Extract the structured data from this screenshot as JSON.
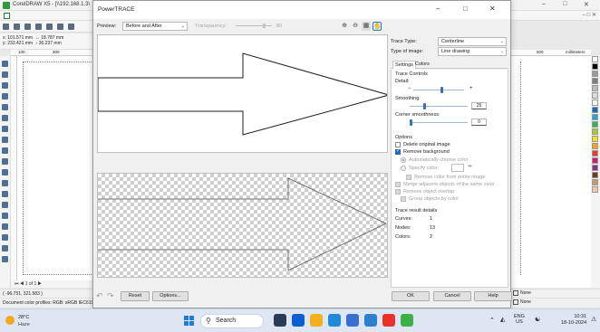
{
  "corel": {
    "title": "CorelDRAW X5 - [\\\\192.168.1.3\\",
    "window_controls": {
      "minimize": "–",
      "maximize": "□",
      "close": "✕"
    },
    "sub_window_controls": "– □ ✕",
    "propbar": {
      "x": "x: 101.571 mm",
      "y": "y: 233.421 mm",
      "w": "18.787 mm",
      "h": "36.237 mm"
    },
    "ruler_top": [
      "100",
      "300"
    ],
    "ruler_right": [
      "500",
      "millimeters"
    ],
    "page_nav": "1 of 1",
    "status_coords": "( -96.751, 321.583 )",
    "status_profile": "Document color profiles: RGB: sRGB IEC61966-2.1; CMYK: ISO Coated v2 (ECI); Grayscale: Dot Gain 15% ▶",
    "fill_status": "None",
    "outline_status": "None",
    "palette": [
      "#ffffff",
      "#000000",
      "#9a9a9a",
      "#7f7f7f",
      "#bcbcbc",
      "#dddddd",
      "#f4f4f4",
      "#1c66b2",
      "#2aa0d8",
      "#3bb34a",
      "#9acd3a",
      "#f2e21b",
      "#f7a21b",
      "#ee3a2a",
      "#d11f6a",
      "#8a2d8f",
      "#6a3d1e",
      "#c99a63",
      "#f4c8a4"
    ]
  },
  "powertrace": {
    "title": "PowerTRACE",
    "window_controls": {
      "minimize": "–",
      "maximize": "□",
      "close": "✕"
    },
    "preview_label": "Preview:",
    "preview_mode": "Before and After",
    "transparency_label": "Transparency:",
    "transparency_value": "80",
    "transparency_level": 0.8,
    "zoom_in_icon": "⊕",
    "zoom_out_icon": "⊖",
    "buttons": {
      "reset": "Reset",
      "options": "Options...",
      "ok": "OK",
      "cancel": "Cancel",
      "help": "Help"
    },
    "undo_icon": "↶",
    "redo_icon": "↷",
    "trace_type_label": "Trace Type:",
    "trace_type_value": "Centerline",
    "image_type_label": "Type of image:",
    "image_type_value": "Line drawing",
    "tabs": [
      "Settings",
      "Colors"
    ],
    "trace_controls_title": "Trace Controls",
    "detail_label": "Detail:",
    "detail_level": 0.55,
    "smoothing_label": "Smoothing:",
    "smoothing_value": "25",
    "smoothing_level": 0.25,
    "corner_label": "Corner smoothness:",
    "corner_value": "0",
    "corner_level": 0,
    "options_title": "Options",
    "delete_original": "Delete original image",
    "remove_background": "Remove background",
    "auto_color": "Automatically choose color",
    "specify_color": "Specify color:",
    "remove_color_entire": "Remove color from entire image",
    "merge_adjacent": "Merge adjacent objects of the same color",
    "remove_overlap": "Remove object overlap",
    "group_by_color": "Group objects by color",
    "results_title": "Trace result details",
    "curves_label": "Curves:",
    "curves_value": "1",
    "nodes_label": "Nodes:",
    "nodes_value": "13",
    "colors_label": "Colors:",
    "colors_value": "2"
  },
  "taskbar": {
    "weather_temp": "28°C",
    "weather_cond": "Haze",
    "search_placeholder": "Search",
    "lang_line1": "ENG",
    "lang_line2": "US",
    "time": "10:31",
    "date": "18-10-2024",
    "app_colors": [
      "#2b3a55",
      "#0b5fd1",
      "#f2b01e",
      "#1f8ad8",
      "#3b6fcf",
      "#2f7fd1",
      "#e8332a",
      "#3db049"
    ]
  }
}
